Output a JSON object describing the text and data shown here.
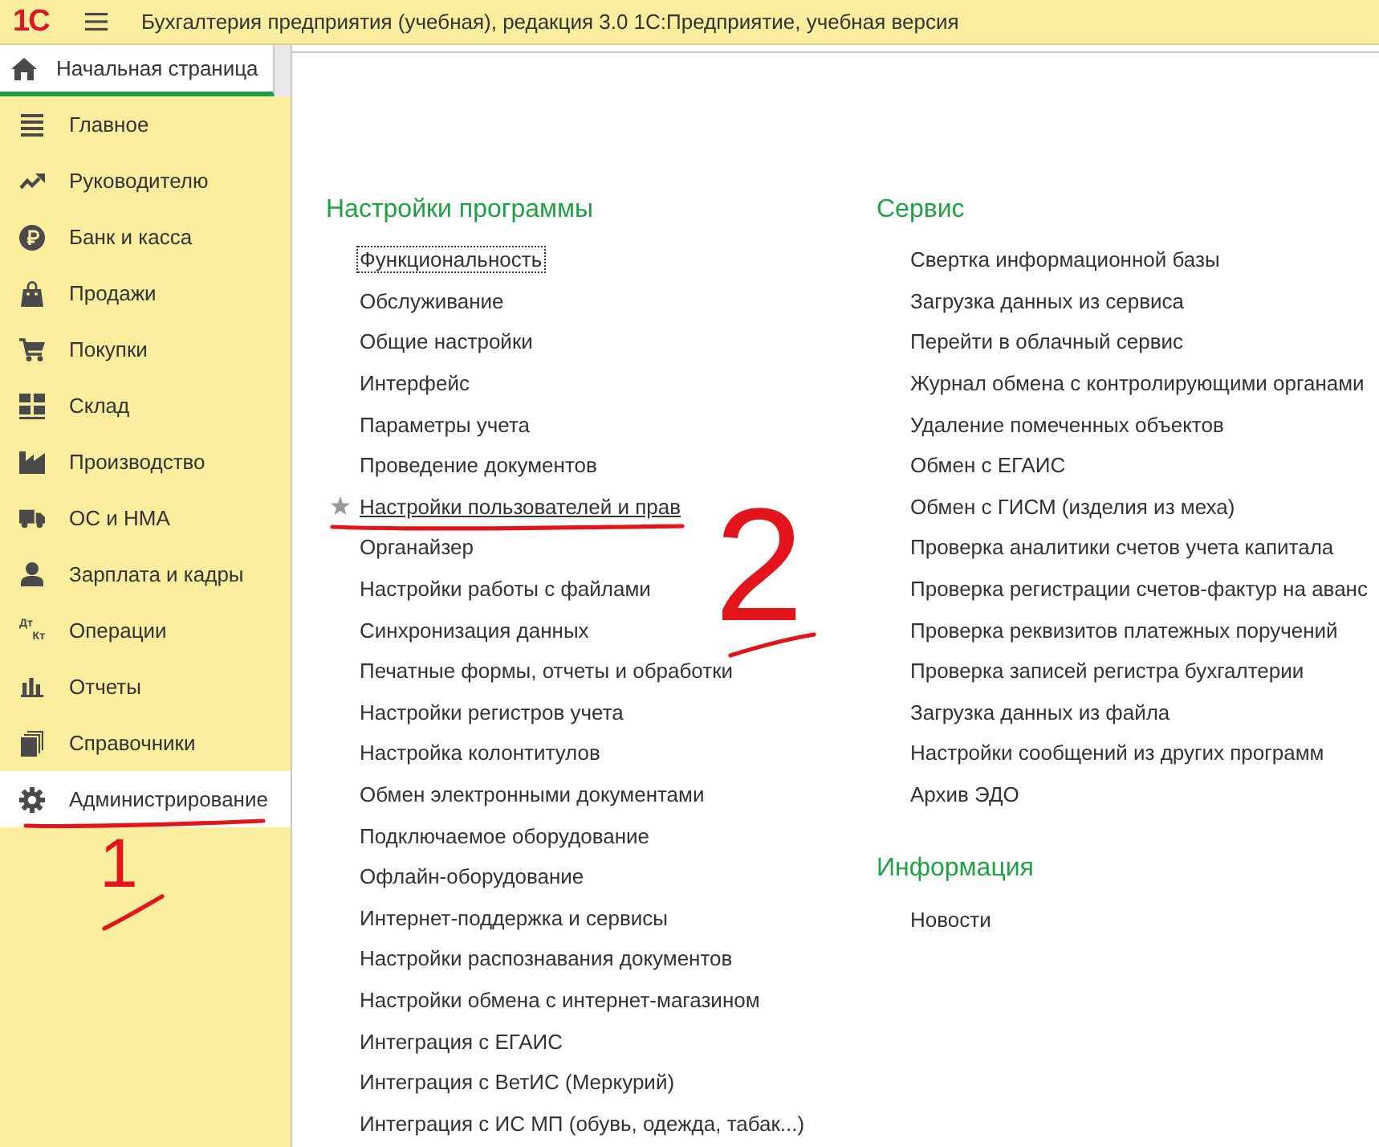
{
  "window": {
    "logo": "1С",
    "title": "Бухгалтерия предприятия (учебная), редакция 3.0 1С:Предприятие, учебная версия"
  },
  "tabs": [
    {
      "label": "Начальная страница",
      "selected": true
    }
  ],
  "sidebar": {
    "items": [
      {
        "label": "Главное",
        "selected": false,
        "marked": false
      },
      {
        "label": "Руководителю",
        "selected": false,
        "marked": false
      },
      {
        "label": "Банк и касса",
        "selected": false,
        "marked": false
      },
      {
        "label": "Продажи",
        "selected": false,
        "marked": false
      },
      {
        "label": "Покупки",
        "selected": false,
        "marked": false
      },
      {
        "label": "Склад",
        "selected": false,
        "marked": false
      },
      {
        "label": "Производство",
        "selected": false,
        "marked": false
      },
      {
        "label": "ОС и НМА",
        "selected": false,
        "marked": false
      },
      {
        "label": "Зарплата и кадры",
        "selected": false,
        "marked": false
      },
      {
        "label": "Операции",
        "selected": false,
        "marked": false,
        "icon_text": [
          "Дт",
          "Кт"
        ]
      },
      {
        "label": "Отчеты",
        "selected": false,
        "marked": false
      },
      {
        "label": "Справочники",
        "selected": false,
        "marked": false
      },
      {
        "label": "Администрирование",
        "selected": true,
        "marked": true,
        "callout": "1"
      }
    ]
  },
  "content": {
    "columns": [
      {
        "sections": [
          {
            "title": "Настройки программы",
            "items": [
              {
                "label": "Функциональность",
                "focused": true,
                "starred": false,
                "hovered": false,
                "marked": false
              },
              {
                "label": "Обслуживание",
                "focused": false,
                "starred": false,
                "hovered": false,
                "marked": false
              },
              {
                "label": "Общие настройки",
                "focused": false,
                "starred": false,
                "hovered": false,
                "marked": false
              },
              {
                "label": "Интерфейс",
                "focused": false,
                "starred": false,
                "hovered": false,
                "marked": false
              },
              {
                "label": "Параметры учета",
                "focused": false,
                "starred": false,
                "hovered": false,
                "marked": false
              },
              {
                "label": "Проведение документов",
                "focused": false,
                "starred": false,
                "hovered": false,
                "marked": false
              },
              {
                "label": "Настройки пользователей и прав",
                "focused": false,
                "starred": true,
                "hovered": true,
                "marked": true,
                "callout": "2"
              },
              {
                "label": "Органайзер",
                "focused": false,
                "starred": false,
                "hovered": false,
                "marked": false
              },
              {
                "label": "Настройки работы с файлами",
                "focused": false,
                "starred": false,
                "hovered": false,
                "marked": false
              },
              {
                "label": "Синхронизация данных",
                "focused": false,
                "starred": false,
                "hovered": false,
                "marked": false
              },
              {
                "label": "Печатные формы, отчеты и обработки",
                "focused": false,
                "starred": false,
                "hovered": false,
                "marked": false
              },
              {
                "label": "Настройки регистров учета",
                "focused": false,
                "starred": false,
                "hovered": false,
                "marked": false
              },
              {
                "label": "Настройка колонтитулов",
                "focused": false,
                "starred": false,
                "hovered": false,
                "marked": false
              },
              {
                "label": "Обмен электронными документами",
                "focused": false,
                "starred": false,
                "hovered": false,
                "marked": false
              },
              {
                "label": "Подключаемое оборудование",
                "focused": false,
                "starred": false,
                "hovered": false,
                "marked": false
              },
              {
                "label": "Офлайн-оборудование",
                "focused": false,
                "starred": false,
                "hovered": false,
                "marked": false
              },
              {
                "label": "Интернет-поддержка и сервисы",
                "focused": false,
                "starred": false,
                "hovered": false,
                "marked": false
              },
              {
                "label": "Настройки распознавания документов",
                "focused": false,
                "starred": false,
                "hovered": false,
                "marked": false
              },
              {
                "label": "Настройки обмена с интернет-магазином",
                "focused": false,
                "starred": false,
                "hovered": false,
                "marked": false
              },
              {
                "label": "Интеграция с ЕГАИС",
                "focused": false,
                "starred": false,
                "hovered": false,
                "marked": false
              },
              {
                "label": "Интеграция с ВетИС (Меркурий)",
                "focused": false,
                "starred": false,
                "hovered": false,
                "marked": false
              },
              {
                "label": "Интеграция с ИС МП (обувь, одежда, табак...)",
                "focused": false,
                "starred": false,
                "hovered": false,
                "marked": false
              }
            ]
          }
        ]
      },
      {
        "sections": [
          {
            "title": "Сервис",
            "items": [
              {
                "label": "Свертка информационной базы",
                "focused": false,
                "starred": false,
                "hovered": false,
                "marked": false
              },
              {
                "label": "Загрузка данных из сервиса",
                "focused": false,
                "starred": false,
                "hovered": false,
                "marked": false
              },
              {
                "label": "Перейти в облачный сервис",
                "focused": false,
                "starred": false,
                "hovered": false,
                "marked": false
              },
              {
                "label": "Журнал обмена с контролирующими органами",
                "focused": false,
                "starred": false,
                "hovered": false,
                "marked": false
              },
              {
                "label": "Удаление помеченных объектов",
                "focused": false,
                "starred": false,
                "hovered": false,
                "marked": false
              },
              {
                "label": "Обмен с ЕГАИС",
                "focused": false,
                "starred": false,
                "hovered": false,
                "marked": false
              },
              {
                "label": "Обмен с ГИСМ (изделия из меха)",
                "focused": false,
                "starred": false,
                "hovered": false,
                "marked": false
              },
              {
                "label": "Проверка аналитики счетов учета капитала",
                "focused": false,
                "starred": false,
                "hovered": false,
                "marked": false
              },
              {
                "label": "Проверка регистрации счетов-фактур на аванс",
                "focused": false,
                "starred": false,
                "hovered": false,
                "marked": false
              },
              {
                "label": "Проверка реквизитов платежных поручений",
                "focused": false,
                "starred": false,
                "hovered": false,
                "marked": false
              },
              {
                "label": "Проверка записей регистра бухгалтерии",
                "focused": false,
                "starred": false,
                "hovered": false,
                "marked": false
              },
              {
                "label": "Загрузка данных из файла",
                "focused": false,
                "starred": false,
                "hovered": false,
                "marked": false
              },
              {
                "label": "Настройки сообщений из других программ",
                "focused": false,
                "starred": false,
                "hovered": false,
                "marked": false
              },
              {
                "label": "Архив ЭДО",
                "focused": false,
                "starred": false,
                "hovered": false,
                "marked": false
              }
            ]
          },
          {
            "title": "Информация",
            "items": [
              {
                "label": "Новости",
                "focused": false,
                "starred": false,
                "hovered": false,
                "marked": false
              }
            ]
          }
        ]
      }
    ]
  }
}
